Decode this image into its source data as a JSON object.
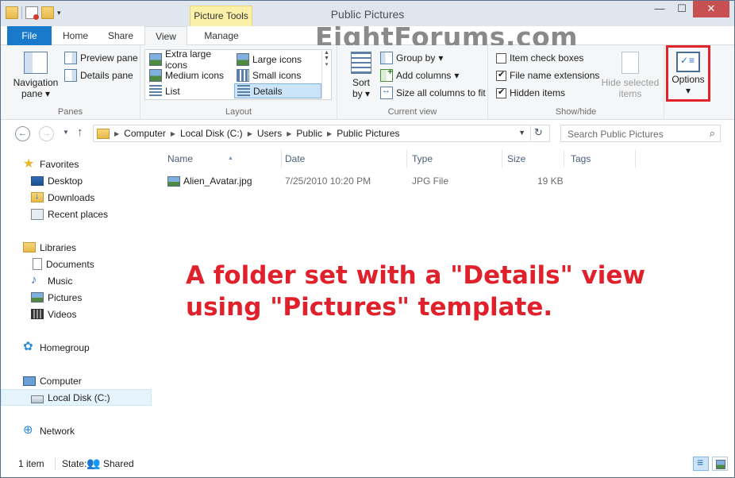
{
  "window": {
    "title": "Public Pictures",
    "contextual_tab": "Picture Tools",
    "controls": {
      "minimize": "—",
      "maximize": "☐",
      "close": "✕"
    }
  },
  "watermark": "EightForums.com",
  "ribbon_tabs": [
    "File",
    "Home",
    "Share",
    "View",
    "Manage"
  ],
  "ribbon_controls": {
    "collapse": "⌃",
    "help": "?"
  },
  "ribbon": {
    "panes": {
      "label": "Panes",
      "navigation_pane": "Navigation pane",
      "preview_pane": "Preview pane",
      "details_pane": "Details pane"
    },
    "layout": {
      "label": "Layout",
      "items": [
        "Extra large icons",
        "Large icons",
        "Medium icons",
        "Small icons",
        "List",
        "Details"
      ],
      "selected": "Details"
    },
    "current_view": {
      "label": "Current view",
      "sort_by": "Sort by",
      "group_by": "Group by",
      "add_columns": "Add columns",
      "size_all_columns": "Size all columns to fit"
    },
    "show_hide": {
      "label": "Show/hide",
      "item_check_boxes": {
        "label": "Item check boxes",
        "checked": false
      },
      "file_name_extensions": {
        "label": "File name extensions",
        "checked": true
      },
      "hidden_items": {
        "label": "Hidden items",
        "checked": true
      },
      "hide_selected_items": "Hide selected items"
    },
    "options": "Options",
    "highlight_color": "#e2242a"
  },
  "address": {
    "crumbs": [
      "Computer",
      "Local Disk (C:)",
      "Users",
      "Public",
      "Public Pictures"
    ],
    "search_placeholder": "Search Public Pictures"
  },
  "nav": {
    "favorites": "Favorites",
    "desktop": "Desktop",
    "downloads": "Downloads",
    "recent_places": "Recent places",
    "libraries": "Libraries",
    "documents": "Documents",
    "music": "Music",
    "pictures": "Pictures",
    "videos": "Videos",
    "homegroup": "Homegroup",
    "computer": "Computer",
    "local_disk": "Local Disk (C:)",
    "network": "Network"
  },
  "columns": [
    "Name",
    "Date",
    "Type",
    "Size",
    "Tags"
  ],
  "files": [
    {
      "name": "Alien_Avatar.jpg",
      "date": "7/25/2010 10:20 PM",
      "type": "JPG File",
      "size": "19 KB",
      "tags": ""
    }
  ],
  "annotation": "A folder set with a \"Details\" view using \"Pictures\" template.",
  "status": {
    "item_count": "1 item",
    "state_label": "State:",
    "state_value": "Shared"
  },
  "colors": {
    "accent": "#1979ca",
    "annotation": "#e0202a",
    "selection": "#cce4f7"
  }
}
